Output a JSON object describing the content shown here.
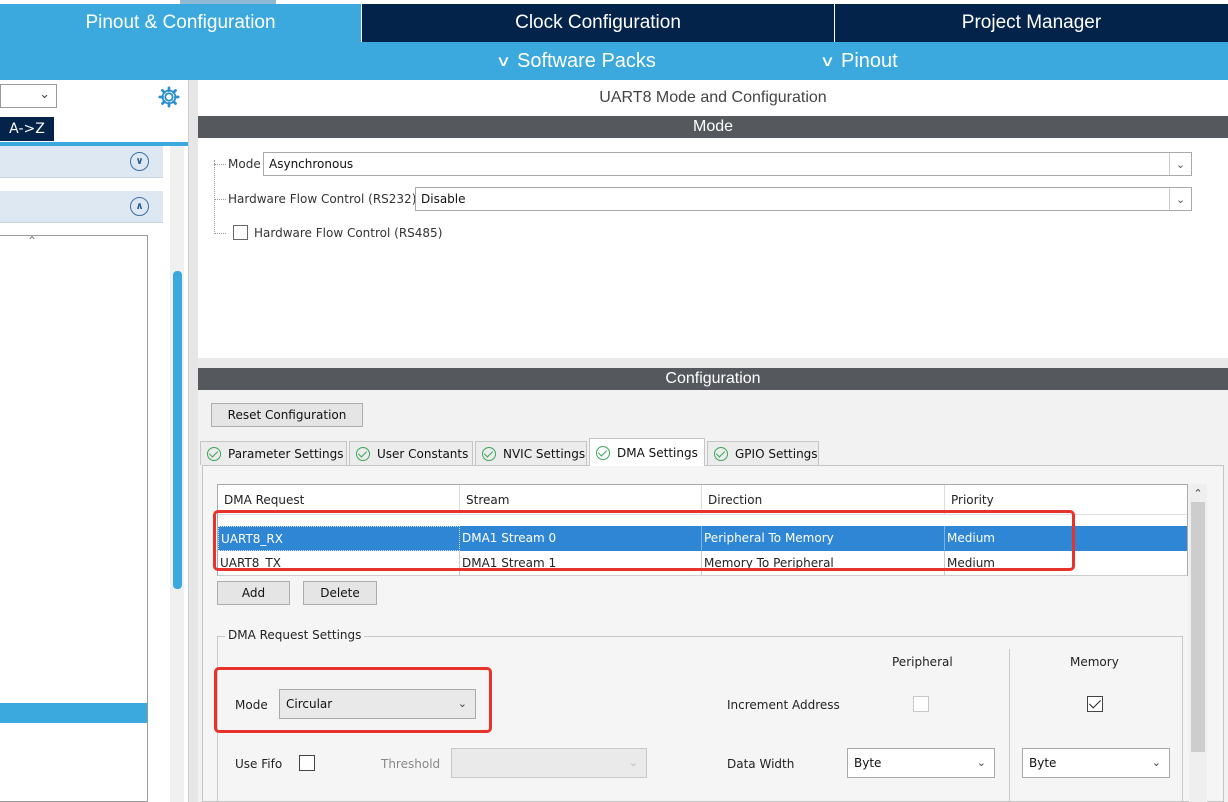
{
  "top_tabs": {
    "pinout_config": "Pinout & Configuration",
    "clock_config": "Clock Configuration",
    "project_manager": "Project Manager"
  },
  "sub_menu": {
    "software_packs": "Software Packs",
    "pinout": "Pinout"
  },
  "left_panel": {
    "sort_button": "A->Z"
  },
  "panel_title": "UART8 Mode and Configuration",
  "mode_section": {
    "header": "Mode",
    "mode_label": "Mode",
    "mode_value": "Asynchronous",
    "hw_flow_rs232_label": "Hardware Flow Control (RS232)",
    "hw_flow_rs232_value": "Disable",
    "hw_flow_rs485_label": "Hardware Flow Control (RS485)"
  },
  "config_section": {
    "header": "Configuration",
    "reset_button": "Reset Configuration",
    "tabs": [
      {
        "label": "Parameter Settings"
      },
      {
        "label": "User Constants"
      },
      {
        "label": "NVIC Settings"
      },
      {
        "label": "DMA Settings"
      },
      {
        "label": "GPIO Settings"
      }
    ],
    "active_tab": "DMA Settings"
  },
  "dma_table": {
    "columns": [
      "DMA Request",
      "Stream",
      "Direction",
      "Priority"
    ],
    "rows": [
      {
        "request": "UART8_RX",
        "stream": "DMA1 Stream 0",
        "direction": "Peripheral To Memory",
        "priority": "Medium"
      },
      {
        "request": "UART8_TX",
        "stream": "DMA1 Stream 1",
        "direction": "Memory To Peripheral",
        "priority": "Medium"
      }
    ],
    "add_button": "Add",
    "delete_button": "Delete"
  },
  "dma_request_settings": {
    "title": "DMA Request Settings",
    "peripheral_header": "Peripheral",
    "memory_header": "Memory",
    "mode_label": "Mode",
    "mode_value": "Circular",
    "increment_address_label": "Increment Address",
    "use_fifo_label": "Use Fifo",
    "threshold_label": "Threshold",
    "data_width_label": "Data Width",
    "peripheral_data_width": "Byte",
    "memory_data_width": "Byte"
  },
  "colors": {
    "accent_blue": "#3ba9dd",
    "dark_navy": "#03234b",
    "section_header": "#55595d",
    "selection_blue": "#2f86d5",
    "highlight_red": "#e8322c"
  }
}
